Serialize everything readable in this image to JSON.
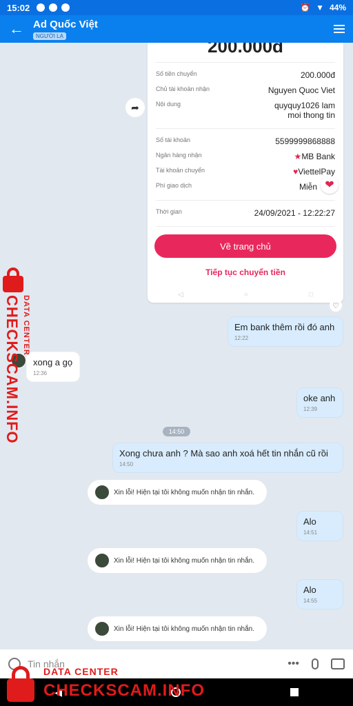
{
  "status_bar": {
    "time": "15:02",
    "battery": "44%"
  },
  "header": {
    "title": "Ad Quốc Việt",
    "tag": "NGƯỜI LẠ"
  },
  "receipt": {
    "amount_top": "200.000đ",
    "rows": [
      {
        "label": "Số tiền chuyển",
        "value": "200.000đ"
      },
      {
        "label": "Chủ tài khoản nhận",
        "value": "Nguyen Quoc Viet"
      },
      {
        "label": "Nội dung",
        "value": "quyquy1026 lam moi thong tin"
      },
      {
        "label": "Số tài khoản",
        "value": "5599999868888"
      },
      {
        "label": "Ngân hàng nhận",
        "value": "MB Bank"
      },
      {
        "label": "Tài khoản chuyển",
        "value": "ViettelPay"
      },
      {
        "label": "Phí giao dịch",
        "value": "Miễn"
      },
      {
        "label": "Thời gian",
        "value": "24/09/2021 - 12:22:27"
      }
    ],
    "home_button": "Về trang chủ",
    "continue_link": "Tiếp tục chuyển tiền"
  },
  "messages": [
    {
      "text": "Em bank thêm rồi đó anh",
      "time": "12:22"
    },
    {
      "text": "xong a gọ",
      "time": "12:36"
    },
    {
      "text": "oke anh",
      "time": "12:39"
    },
    {
      "text": "Xong chưa anh ? Mà sao anh xoá hết tin nhắn cũ rồi",
      "time": "14:50"
    },
    {
      "text": "Alo",
      "time": "14:51"
    },
    {
      "text": "Alo",
      "time": "14:55"
    }
  ],
  "time_separator": "14:50",
  "system_notice": "Xin lỗi! Hiện tại tôi không muốn nhận tin nhắn.",
  "input": {
    "placeholder": "Tin nhắn"
  },
  "watermark": {
    "side_small": "DATA CENTER",
    "side_big": "CHECKSCAM.INFO",
    "bottom_small": "DATA CENTER",
    "bottom_big": "CHECKSCAM.INFO"
  },
  "icons": [
    "back-arrow-icon",
    "menu-icon",
    "share-icon",
    "heart-icon",
    "emoji-icon",
    "more-icon",
    "mic-icon",
    "image-icon"
  ]
}
